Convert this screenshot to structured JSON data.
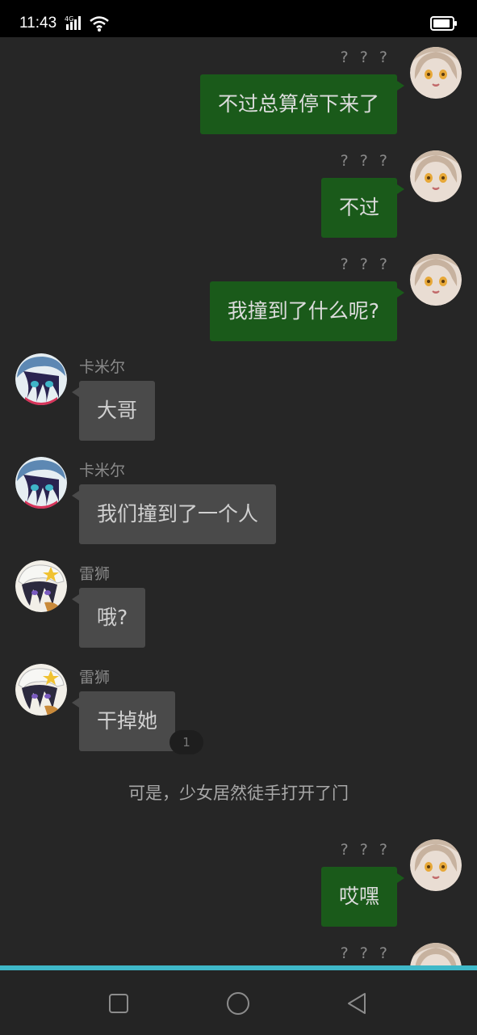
{
  "status_bar": {
    "time": "11:43",
    "network": "4G"
  },
  "messages": [
    {
      "side": "right",
      "name": "? ? ?",
      "text": "不过总算停下来了",
      "avatar": "girl-avatar"
    },
    {
      "side": "right",
      "name": "? ? ?",
      "text": "不过",
      "avatar": "girl-avatar"
    },
    {
      "side": "right",
      "name": "? ? ?",
      "text": "我撞到了什么呢?",
      "avatar": "girl-avatar"
    },
    {
      "side": "left",
      "name": "卡米尔",
      "text": "大哥",
      "avatar": "camille-avatar"
    },
    {
      "side": "left",
      "name": "卡米尔",
      "text": "我们撞到了一个人",
      "avatar": "camille-avatar"
    },
    {
      "side": "left",
      "name": "雷狮",
      "text": "哦?",
      "avatar": "leishi-avatar"
    },
    {
      "side": "left",
      "name": "雷狮",
      "text": "干掉她",
      "avatar": "leishi-avatar",
      "badge": "1"
    },
    {
      "side": "right",
      "name": "? ? ?",
      "text": "哎嘿",
      "avatar": "girl-avatar"
    },
    {
      "side": "right",
      "name": "? ? ?",
      "text": "",
      "avatar": "girl-avatar"
    }
  ],
  "narration": "可是，少女居然徒手打开了门",
  "colors": {
    "background": "#262626",
    "bubble_right": "#1a5a1a",
    "bubble_left": "#4a4a4a",
    "accent": "#3fb8c8"
  },
  "nav": {
    "icons": [
      "recents-square-icon",
      "home-circle-icon",
      "back-triangle-icon"
    ]
  }
}
